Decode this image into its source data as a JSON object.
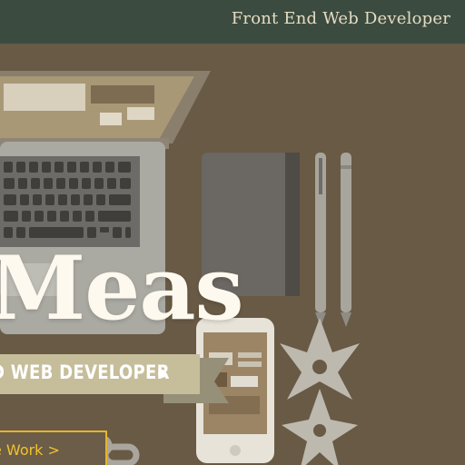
{
  "header": {
    "title": "Front End Web Developer"
  },
  "hero": {
    "name": "Meas",
    "ribbon_label": "D WEB DEVELOPER",
    "work_link": "e Work >"
  },
  "colors": {
    "header_bg": "#3c4b3f",
    "hero_bg": "#685a45",
    "link_accent": "#e7b52a"
  },
  "icons": [
    "laptop-icon",
    "notebook-icon",
    "pen-icon",
    "pencil-icon",
    "smartphone-icon",
    "shuriken-icon",
    "chain-icon"
  ]
}
